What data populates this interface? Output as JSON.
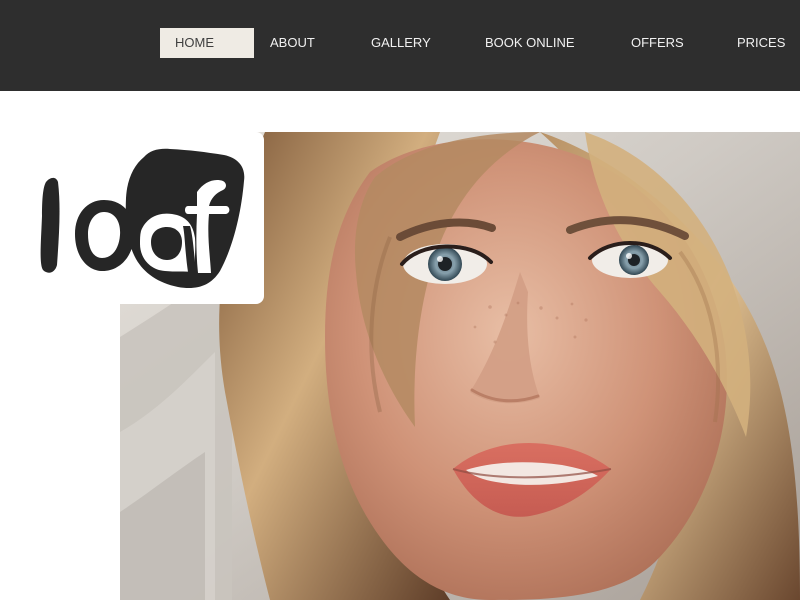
{
  "nav": {
    "items": [
      {
        "label": "HOME",
        "active": true
      },
      {
        "label": "ABOUT",
        "active": false
      },
      {
        "label": "GALLERY",
        "active": false
      },
      {
        "label": "BOOK ONLINE",
        "active": false
      },
      {
        "label": "OFFERS",
        "active": false
      },
      {
        "label": "PRICES",
        "active": false
      }
    ]
  },
  "logo": {
    "text": "loaf"
  },
  "colors": {
    "header_bg": "#2e2e2e",
    "nav_text": "#f1f1f1",
    "active_bg": "#efebe4",
    "active_text": "#3f3f3f",
    "logo_dark": "#262626"
  },
  "hero": {
    "subject": "portrait-photo"
  }
}
